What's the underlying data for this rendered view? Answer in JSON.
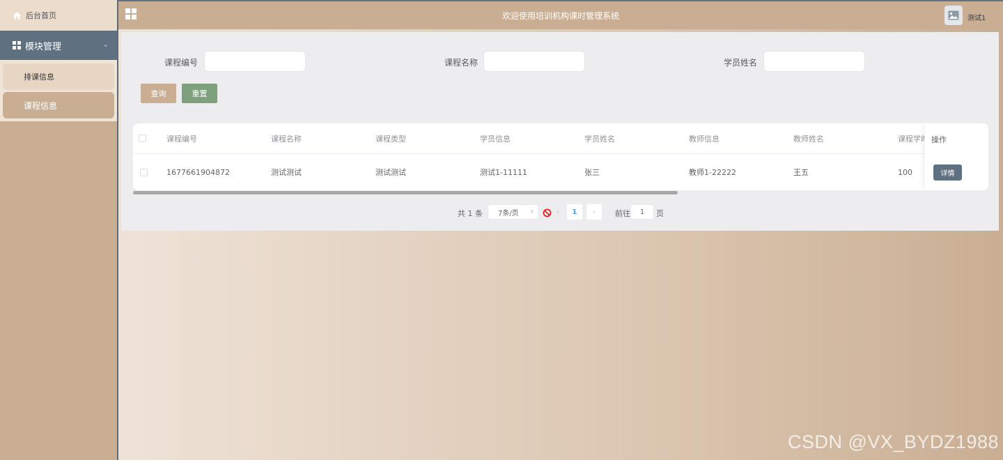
{
  "sidebar": {
    "home_label": "后台首页",
    "group_label": "模块管理",
    "items": [
      {
        "label": "排课信息"
      },
      {
        "label": "课程信息"
      }
    ]
  },
  "topbar": {
    "title": "欢迎使用培训机构课时管理系统",
    "user_name": "测试1"
  },
  "search": {
    "fields": [
      {
        "label": "课程编号",
        "value": ""
      },
      {
        "label": "课程名称",
        "value": ""
      },
      {
        "label": "学员姓名",
        "value": ""
      }
    ],
    "query_label": "查询",
    "reset_label": "重置"
  },
  "table": {
    "columns": [
      "课程编号",
      "课程名称",
      "课程类型",
      "学员信息",
      "学员姓名",
      "教师信息",
      "教师姓名",
      "课程学时",
      "操作"
    ],
    "rows": [
      {
        "course_no": "1677661904872",
        "course_name": "测试测试",
        "course_type": "测试测试",
        "student_info": "测试1-11111",
        "student_name": "张三",
        "teacher_info": "教师1-22222",
        "teacher_name": "王五",
        "hours": "100",
        "action_label": "详情"
      }
    ]
  },
  "pagination": {
    "total_text": "共 1 条",
    "page_size": "7条/页",
    "current_page": "1",
    "goto_label": "前往",
    "goto_value": "1",
    "page_suffix": "页"
  },
  "watermark": "CSDN @VX_BYDZ1988",
  "colors": {
    "accent_tan": "#c9ae93",
    "slate": "#5f7181",
    "reset_green": "#7ea07c",
    "page_active": "#409eff"
  }
}
